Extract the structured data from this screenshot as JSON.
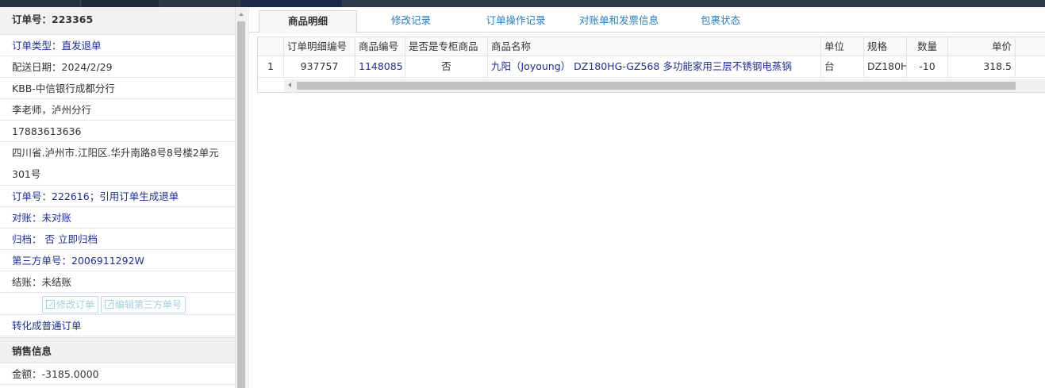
{
  "order_panel": {
    "order_no_label": "订单号：223365",
    "order_type": "订单类型：直发退单",
    "delivery_date": "配送日期：2024/2/29",
    "customer_org": "KBB-中信银行成都分行",
    "contact": "李老师，泸州分行",
    "phone": "17883613636",
    "address": "四川省.泸州市.江阳区.华升南路8号8号楼2单元301号",
    "ref_order": "订单号：222616；引用订单生成退单",
    "reconcile": "对账：未对账",
    "archive": "归档： 否 立即归档",
    "third_party_no": "第三方单号：2006911292W",
    "settle": "结账：未结账",
    "edit_order_button": "修改订单",
    "edit_third_party_button": "编辑第三方单号",
    "convert_link": "转化成普通订单",
    "sales_section": "销售信息",
    "amount": "金额：-3185.0000"
  },
  "tabs": [
    {
      "label": "商品明细",
      "active": true
    },
    {
      "label": "修改记录",
      "active": false
    },
    {
      "label": "订单操作记录",
      "active": false
    },
    {
      "label": "对账单和发票信息",
      "active": false
    },
    {
      "label": "包裹状态",
      "active": false
    }
  ],
  "grid": {
    "headers": [
      "订单明细编号",
      "商品编号",
      "是否是专柜商品",
      "商品名称",
      "单位",
      "规格",
      "数量",
      "单价"
    ],
    "rows": [
      {
        "index": "1",
        "detail_no": "937757",
        "product_no": "1148085",
        "is_counter": "否",
        "product_name": "九阳（Joyoung） DZ180HG-GZ568 多功能家用三层不锈钢电蒸锅",
        "unit": "台",
        "spec": "DZ180H",
        "qty": "-10",
        "price": "318.5"
      }
    ]
  },
  "colors": {
    "link_blue": "#1e2f8f",
    "tab_blue": "#2a7db8",
    "topbar": "#2f3a48"
  }
}
